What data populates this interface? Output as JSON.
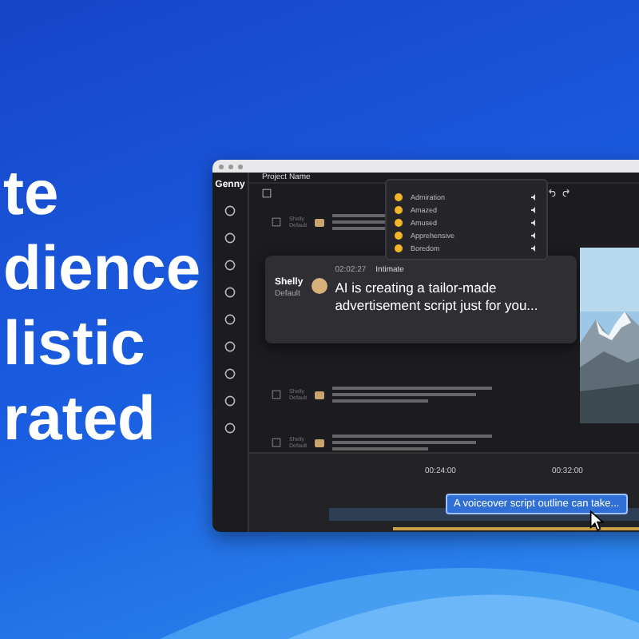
{
  "headline": [
    "te",
    "dience",
    "listic",
    "rated"
  ],
  "app": {
    "brand": "Genny",
    "project": "Project Name",
    "emotions": [
      {
        "name": "Admiration"
      },
      {
        "name": "Amazed"
      },
      {
        "name": "Amused"
      },
      {
        "name": "Apprehensive"
      },
      {
        "name": "Boredom"
      }
    ],
    "rows": [
      {
        "speaker": "Shelly",
        "style": "Default"
      },
      {
        "speaker": "Shelly",
        "style": "Default"
      },
      {
        "speaker": "Shelly",
        "style": "Default"
      }
    ],
    "focused": {
      "speaker": "Shelly",
      "style": "Default",
      "time": "02:02:27",
      "emotion": "Intimate",
      "text": "AI is creating a tailor-made advertisement script just for you..."
    },
    "timeline": {
      "ticks": [
        "00:24:00",
        "00:32:00"
      ]
    },
    "tooltip": "A voiceover script outline can take..."
  }
}
